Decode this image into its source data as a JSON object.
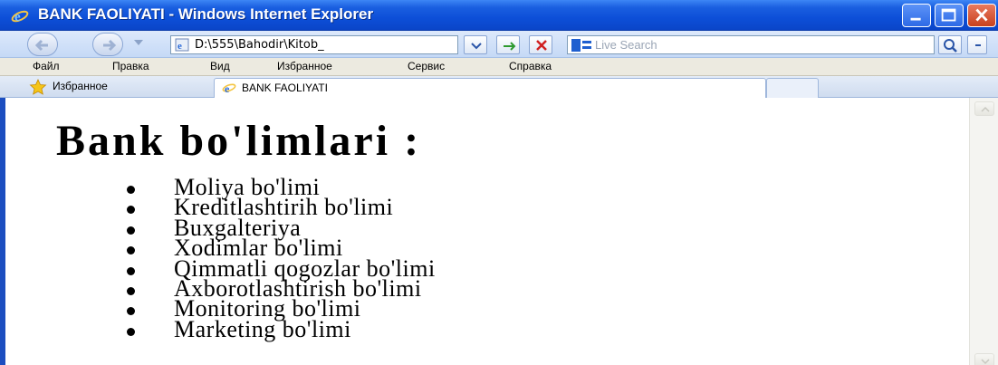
{
  "window": {
    "title": "BANK FAOLIYATI - Windows Internet Explorer"
  },
  "address_bar": {
    "url": "D:\\555\\Bahodir\\Kitob_",
    "search_placeholder": "Live Search"
  },
  "menu": {
    "items": [
      "Файл",
      "Правка",
      "Вид",
      "Избранное",
      "Сервис",
      "Справка"
    ]
  },
  "tabs": {
    "favorites_label": "Избранное",
    "active_tab": "BANK FAOLIYATI"
  },
  "page": {
    "heading": "Bank bo'limlari :",
    "departments": [
      "Moliya bo'limi",
      "Kreditlashtirih bo'limi",
      "Buxgalteriya",
      "Xodimlar bo'limi",
      "Qimmatli qogozlar bo'limi",
      "Axborotlashtirish bo'limi",
      "Monitoring bo'limi",
      "Marketing bo'limi"
    ]
  },
  "colors": {
    "titlebar": "#0d4fd8",
    "frame": "#1c4ec0",
    "menubar": "#eceae0"
  }
}
